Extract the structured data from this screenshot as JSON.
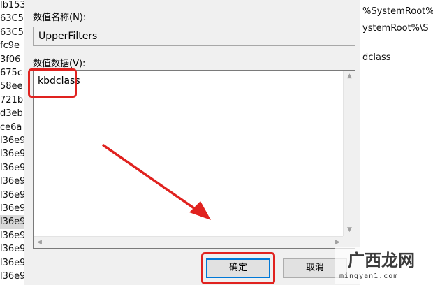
{
  "background_list": {
    "rows": [
      "lb153",
      "63C5",
      "63C5",
      "fc9e",
      "3f06",
      "675c",
      "58ee",
      "721b",
      "d3eb",
      "ce6a",
      "l36e9",
      "l36e9",
      "l36e9",
      "l36e9",
      "l36e9",
      "l36e9",
      "l36e9",
      "l36e9",
      "l36e9",
      "l36e9",
      "l36e9"
    ],
    "selected_index": 16
  },
  "background_values": {
    "rows": [
      "%SystemRoot%",
      "ystemRoot%\\S",
      "",
      "dclass"
    ]
  },
  "dialog": {
    "name_label": "数值名称(N):",
    "name_value": "UpperFilters",
    "data_label": "数值数据(V):",
    "data_value": "kbdclass",
    "ok_label": "确定",
    "cancel_label": "取消"
  },
  "annotations": {
    "highlight_color": "#e0221f"
  },
  "watermark": {
    "url": "mingyan1.com"
  }
}
